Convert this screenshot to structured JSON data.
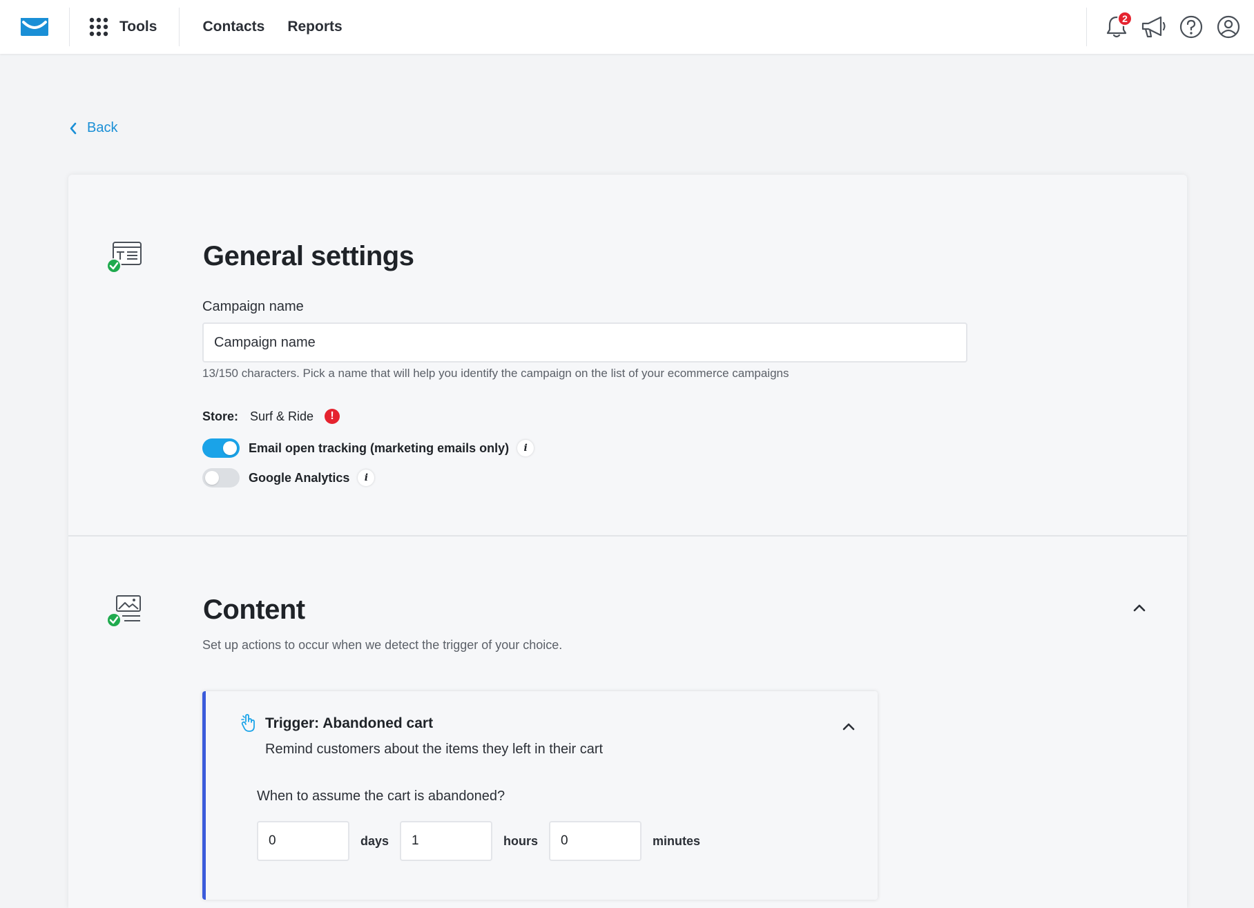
{
  "nav": {
    "tools_label": "Tools",
    "links": [
      "Contacts",
      "Reports"
    ],
    "notification_count": "2"
  },
  "back_label": "Back",
  "general": {
    "title": "General settings",
    "campaign_name_label": "Campaign name",
    "campaign_name_value": "Campaign name",
    "helper": "13/150 characters. Pick a name that will help you identify the campaign on the list of your ecommerce campaigns",
    "store_label": "Store:",
    "store_value": "Surf & Ride",
    "toggles": [
      {
        "label": "Email open tracking (marketing emails only)",
        "on": true
      },
      {
        "label": "Google Analytics",
        "on": false
      }
    ]
  },
  "content": {
    "title": "Content",
    "subtitle": "Set up actions to occur when we detect the trigger of your choice.",
    "trigger": {
      "title": "Trigger: Abandoned cart",
      "description": "Remind customers about the items they left in their cart",
      "question": "When to assume the cart is abandoned?",
      "days_value": "0",
      "days_label": "days",
      "hours_value": "1",
      "hours_label": "hours",
      "minutes_value": "0",
      "minutes_label": "minutes"
    }
  },
  "colors": {
    "accent": "#1a8fd6",
    "toggle_on": "#1aa3e8",
    "trigger_border": "#3b5bdb",
    "badge": "#e5232f",
    "success": "#1faa4e"
  }
}
